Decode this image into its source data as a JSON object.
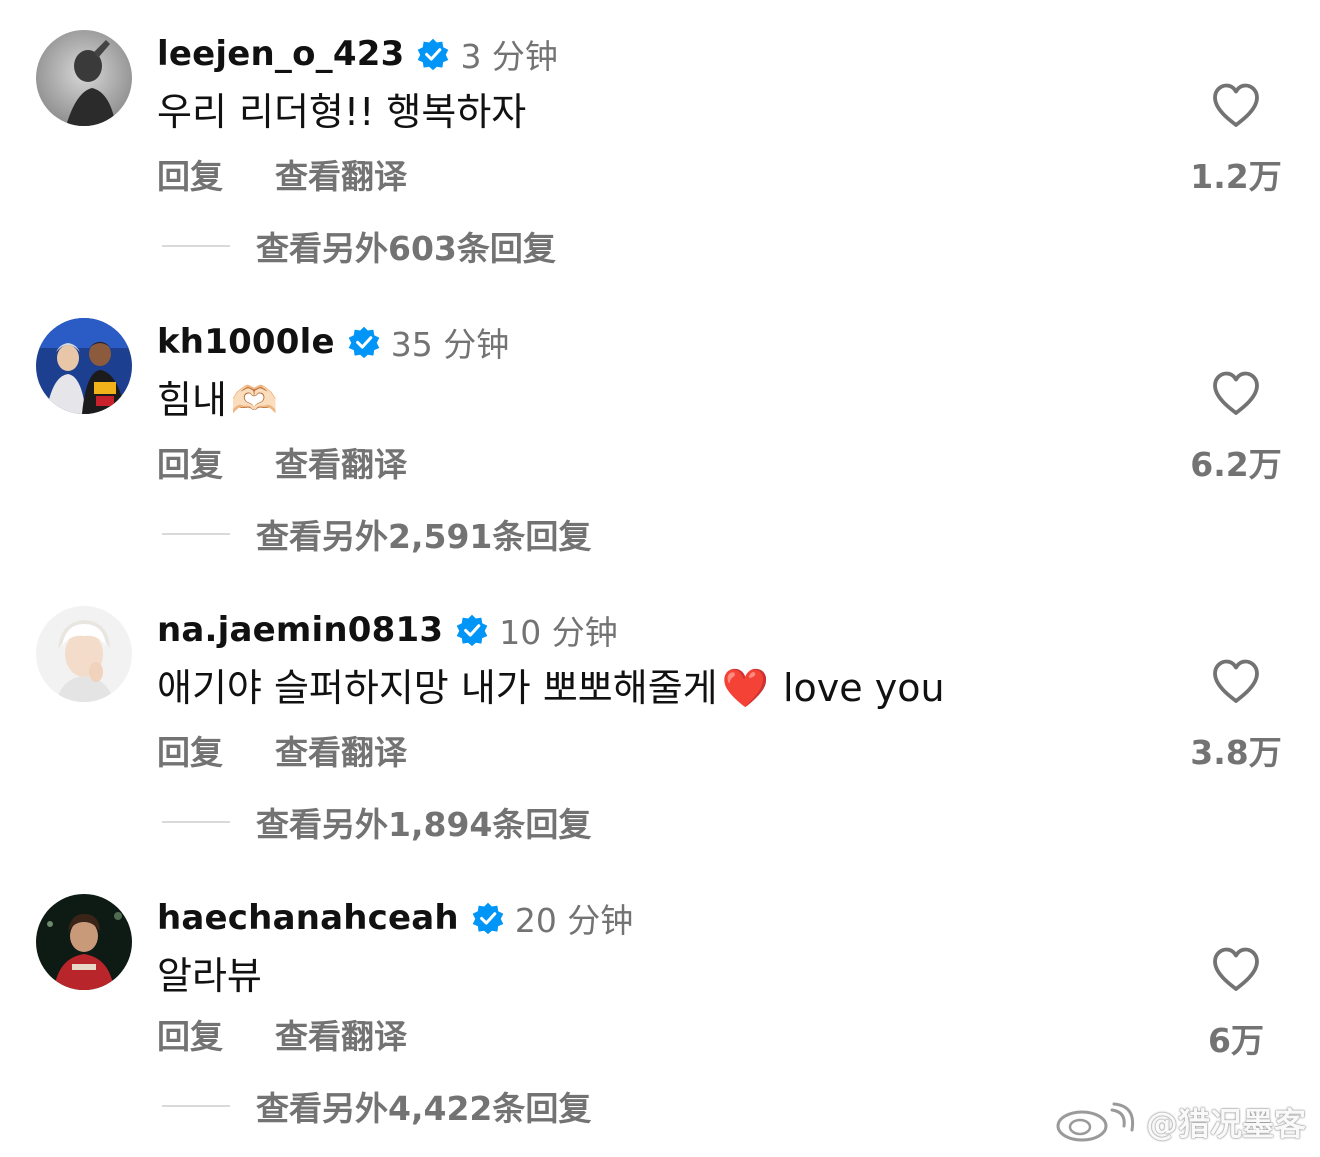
{
  "comments": [
    {
      "username": "leejen_o_423",
      "time": "3 分钟",
      "text": "우리 리더형!! 행복하자",
      "emoji": "",
      "text_after": "",
      "reply_label": "回复",
      "translate_label": "查看翻译",
      "more_replies": "查看另外603条回复",
      "likes": "1.2万",
      "avatar_icon": "avatar-photo-bw"
    },
    {
      "username": "kh1000le",
      "time": "35 分钟",
      "text": "힘내",
      "emoji": "🫶🏻",
      "text_after": "",
      "reply_label": "回复",
      "translate_label": "查看翻译",
      "more_replies": "查看另外2,591条回复",
      "likes": "6.2万",
      "avatar_icon": "avatar-photo-two-people"
    },
    {
      "username": "na.jaemin0813",
      "time": "10 分钟",
      "text": "애기야 슬퍼하지망 내가 뽀뽀해줄게",
      "emoji": "❤️",
      "text_after": "love you",
      "reply_label": "回复",
      "translate_label": "查看翻译",
      "more_replies": "查看另外1,894条回复",
      "likes": "3.8万",
      "avatar_icon": "avatar-photo-light"
    },
    {
      "username": "haechanahceah",
      "time": "20 分钟",
      "text": "알라뷰",
      "emoji": "",
      "text_after": "",
      "reply_label": "回复",
      "translate_label": "查看翻译",
      "more_replies": "查看另外4,422条回复",
      "likes": "6万",
      "avatar_icon": "avatar-photo-night"
    }
  ],
  "icons": {
    "verified": "verified-badge-icon",
    "like": "heart-outline-icon"
  },
  "colors": {
    "verified": "#0095F6",
    "secondary_text": "#737373",
    "primary_text": "#111111"
  },
  "watermark": {
    "text": "@猎况墨客",
    "icon": "weibo-logo-icon"
  }
}
